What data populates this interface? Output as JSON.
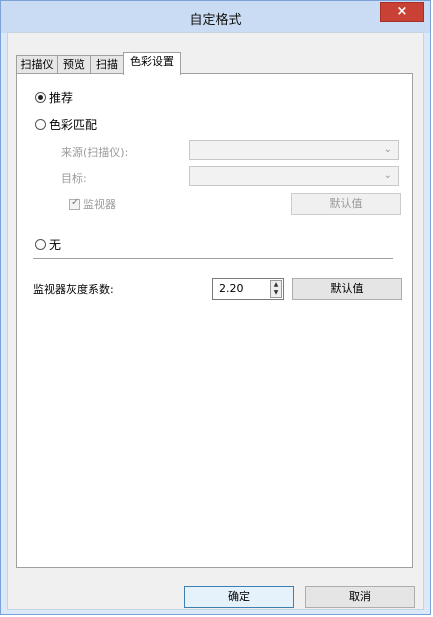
{
  "window": {
    "title": "自定格式",
    "close_label": "×"
  },
  "tabs": [
    {
      "label": "扫描仪",
      "active": false
    },
    {
      "label": "预览",
      "active": false
    },
    {
      "label": "扫描",
      "active": false
    },
    {
      "label": "色彩设置",
      "active": true
    }
  ],
  "color_settings": {
    "option_recommended": "推荐",
    "option_color_matching": "色彩匹配",
    "source_label": "来源(扫描仪):",
    "source_value": "",
    "target_label": "目标:",
    "target_value": "",
    "monitor_checkbox_label": "监视器",
    "monitor_checked": true,
    "defaults_button_disabled": "默认值",
    "option_none": "无",
    "selected_option": "recommended"
  },
  "gamma": {
    "label": "监视器灰度系数:",
    "value": "2.20",
    "defaults_button": "默认值"
  },
  "footer": {
    "ok_label": "确定",
    "cancel_label": "取消"
  },
  "icons": {
    "close": "close-icon",
    "dropdown": "chevron-down-icon",
    "spin": "spin-arrows-icon",
    "check": "checkmark-icon"
  }
}
